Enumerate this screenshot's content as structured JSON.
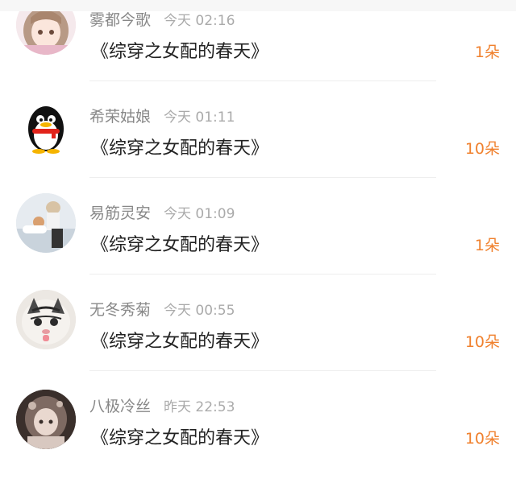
{
  "rows": [
    {
      "name": "雾都今歌",
      "time": "今天 02:16",
      "title": "《综穿之女配的春天》",
      "amount": "1朵",
      "avatar": "anime-girl-avatar"
    },
    {
      "name": "希荣姑娘",
      "time": "今天 01:11",
      "title": "《综穿之女配的春天》",
      "amount": "10朵",
      "avatar": "penguin-avatar"
    },
    {
      "name": "易筋灵安",
      "time": "今天 01:09",
      "title": "《综穿之女配的春天》",
      "amount": "1朵",
      "avatar": "photo-avatar"
    },
    {
      "name": "无冬秀菊",
      "time": "今天 00:55",
      "title": "《综穿之女配的春天》",
      "amount": "10朵",
      "avatar": "cat-avatar"
    },
    {
      "name": "八极冷丝",
      "time": "昨天 22:53",
      "title": "《综穿之女配的春天》",
      "amount": "10朵",
      "avatar": "anime-dark-avatar"
    }
  ],
  "colors": {
    "amount": "#f0812e",
    "name": "#888888",
    "title": "#222222"
  }
}
